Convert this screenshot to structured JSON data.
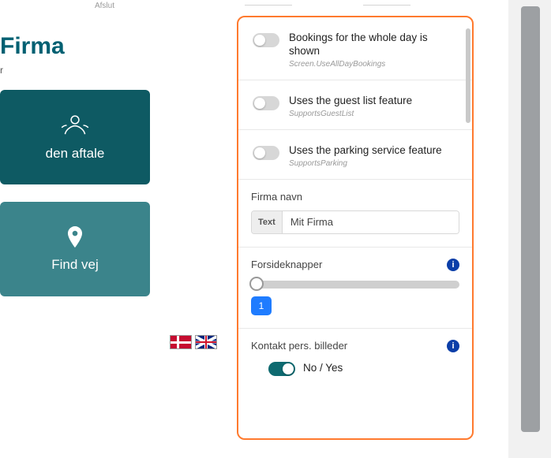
{
  "preview": {
    "afslut_label": "Afslut",
    "company_title": "Firma",
    "sub_text": "r",
    "tile1_label": "den aftale",
    "tile2_label": "Find vej"
  },
  "settings": {
    "toggle1": {
      "title": "Bookings for the whole day is shown",
      "sub": "Screen.UseAllDayBookings"
    },
    "toggle2": {
      "title": "Uses the guest list feature",
      "sub": "SupportsGuestList"
    },
    "toggle3": {
      "title": "Uses the parking service feature",
      "sub": "SupportsParking"
    },
    "firma_navn": {
      "label": "Firma navn",
      "addon": "Text",
      "value": "Mit Firma"
    },
    "forsideknapper": {
      "label": "Forsideknapper",
      "value": "1"
    },
    "kontakt": {
      "label": "Kontakt pers. billeder",
      "toggle_label": "No / Yes"
    }
  },
  "info_glyph": "i"
}
